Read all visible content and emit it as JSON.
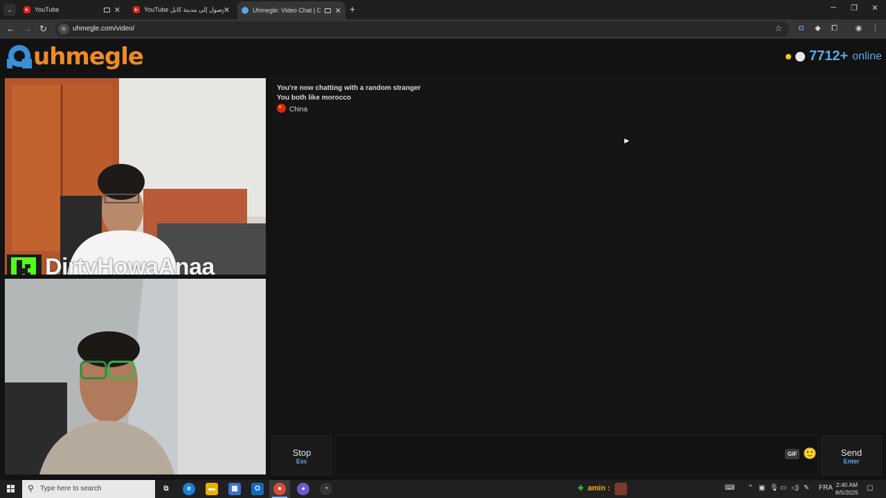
{
  "browser": {
    "tabs": [
      {
        "title": "YouTube",
        "favicon": "youtube-icon"
      },
      {
        "title": "YouTube الوصول إلى مدينة كابل",
        "favicon": "youtube-icon"
      },
      {
        "title": "Uhmegle: Video Chat | Ome",
        "favicon": "uhmegle-icon"
      }
    ],
    "url": "uhmegle.com/video/",
    "tab_menu_icon": "chevron-down-icon",
    "new_tab_icon": "plus-icon"
  },
  "site": {
    "logo_text": "uhmegle",
    "online_count": "7712+",
    "online_label": "online",
    "brand_color": "#f08a24",
    "accent_color": "#5fa8e8"
  },
  "stream": {
    "overlay_name": "DirtyHowaAnaa"
  },
  "chat": {
    "messages": [
      "You're now chatting with a random stranger",
      "You both like morocco"
    ],
    "country": "China"
  },
  "controls": {
    "stop_label": "Stop",
    "stop_key": "Esc",
    "send_label": "Send",
    "send_key": "Enter",
    "gif_label": "GIF",
    "emoji": "🙂"
  },
  "taskbar": {
    "search_placeholder": "Type here to search",
    "user_label": "amin :",
    "language": "FRA",
    "time": "2:40 AM",
    "date": "8/5/2025"
  }
}
